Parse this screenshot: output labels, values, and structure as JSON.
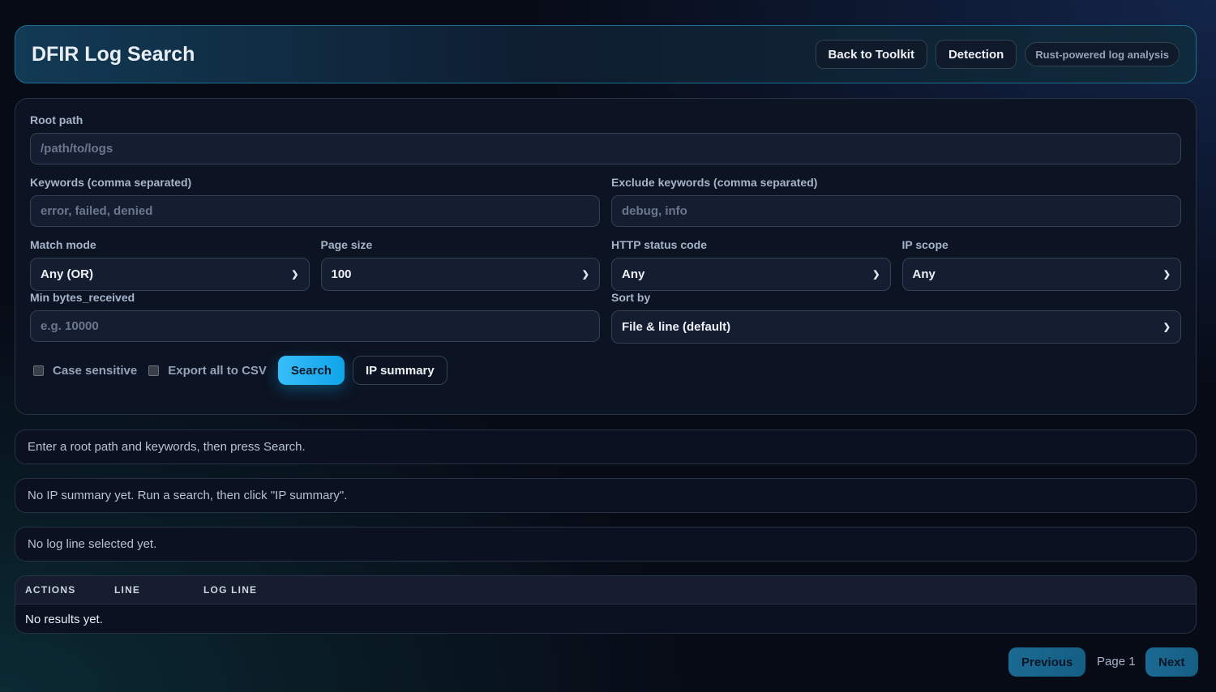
{
  "header": {
    "title": "DFIR Log Search",
    "back_label": "Back to Toolkit",
    "detection_label": "Detection",
    "tagline": "Rust-powered log analysis"
  },
  "form": {
    "root_path": {
      "label": "Root path",
      "placeholder": "/path/to/logs"
    },
    "keywords": {
      "label": "Keywords (comma separated)",
      "placeholder": "error, failed, denied"
    },
    "exclude": {
      "label": "Exclude keywords (comma separated)",
      "placeholder": "debug, info"
    },
    "match_mode": {
      "label": "Match mode",
      "value": "Any (OR)"
    },
    "page_size": {
      "label": "Page size",
      "value": "100"
    },
    "http_status": {
      "label": "HTTP status code",
      "value": "Any"
    },
    "ip_scope": {
      "label": "IP scope",
      "value": "Any"
    },
    "min_bytes": {
      "label": "Min bytes_received",
      "placeholder": "e.g. 10000"
    },
    "sort_by": {
      "label": "Sort by",
      "value": "File & line (default)"
    },
    "case_sensitive": {
      "label": "Case sensitive",
      "checked": false
    },
    "export_csv": {
      "label": "Export all to CSV",
      "checked": false
    },
    "search_label": "Search",
    "ip_summary_label": "IP summary"
  },
  "status": {
    "search": "Enter a root path and keywords, then press Search.",
    "ip_summary": "No IP summary yet. Run a search, then click \"IP summary\".",
    "selection": "No log line selected yet."
  },
  "table": {
    "columns": [
      "ACTIONS",
      "LINE",
      "LOG LINE"
    ],
    "empty": "No results yet."
  },
  "pagination": {
    "previous": "Previous",
    "page": "Page 1",
    "next": "Next"
  }
}
